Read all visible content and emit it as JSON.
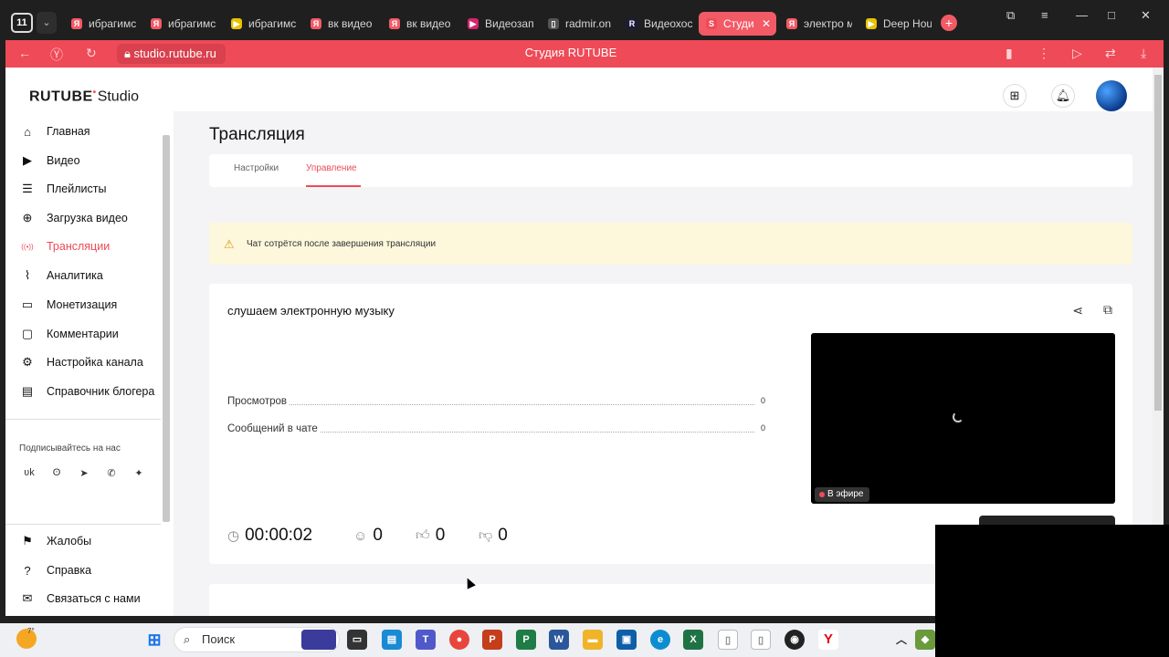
{
  "browser": {
    "tab_count": "11",
    "tabs": [
      {
        "label": "ибрагимс",
        "fav": "Я",
        "color": "#f25a66"
      },
      {
        "label": "ибрагимс",
        "fav": "Я",
        "color": "#f25a66"
      },
      {
        "label": "ибрагимс",
        "fav": "▶",
        "color": "#e8c200"
      },
      {
        "label": "вк видео",
        "fav": "Я",
        "color": "#f25a66"
      },
      {
        "label": "вк видео",
        "fav": "Я",
        "color": "#f25a66"
      },
      {
        "label": "Видеозап",
        "fav": "▶",
        "color": "#d6246e"
      },
      {
        "label": "radmir.on",
        "fav": "▯",
        "color": "#555"
      },
      {
        "label": "Видеохос",
        "fav": "R",
        "color": "#1a1a3a"
      },
      {
        "label": "Студи",
        "fav": "S",
        "color": "#ef4a57",
        "active": true
      },
      {
        "label": "электро м",
        "fav": "Я",
        "color": "#f25a66"
      },
      {
        "label": "Deep Hou",
        "fav": "▶",
        "color": "#e8c200"
      }
    ],
    "url": "studio.rutube.ru",
    "page_title": "Студия RUTUBE"
  },
  "app": {
    "logo_main": "RUTUBE",
    "logo_studio": "Studio",
    "sidebar": [
      {
        "label": "Главная",
        "icon": "home-icon",
        "glyph": "⌂"
      },
      {
        "label": "Видео",
        "icon": "video-icon",
        "glyph": "▶"
      },
      {
        "label": "Плейлисты",
        "icon": "playlist-icon",
        "glyph": "☰"
      },
      {
        "label": "Загрузка видео",
        "icon": "upload-icon",
        "glyph": "⊕"
      },
      {
        "label": "Трансляции",
        "icon": "broadcast-icon",
        "glyph": "((•))",
        "active": true
      },
      {
        "label": "Аналитика",
        "icon": "analytics-icon",
        "glyph": "⌇"
      },
      {
        "label": "Монетизация",
        "icon": "monetization-icon",
        "glyph": "▭"
      },
      {
        "label": "Комментарии",
        "icon": "comments-icon",
        "glyph": "▢"
      },
      {
        "label": "Настройка канала",
        "icon": "settings-icon",
        "glyph": "⚙"
      },
      {
        "label": "Справочник блогера",
        "icon": "handbook-icon",
        "glyph": "▤"
      }
    ],
    "subscribe_heading": "Подписывайтесь на нас",
    "social": [
      "vk",
      "ok",
      "telegram",
      "viber",
      "dzen"
    ],
    "social_glyphs": [
      "ʋk",
      "ʘ",
      "➤",
      "✆",
      "✦"
    ],
    "bottom_nav": [
      {
        "label": "Жалобы",
        "icon": "flag-icon",
        "glyph": "⚑"
      },
      {
        "label": "Справка",
        "icon": "help-icon",
        "glyph": "?"
      },
      {
        "label": "Связаться с нами",
        "icon": "mail-icon",
        "glyph": "✉"
      }
    ],
    "page_title": "Трансляция",
    "tabs": [
      {
        "label": "Настройки"
      },
      {
        "label": "Управление",
        "active": true
      }
    ],
    "warning": "Чат сотрётся после завершения трансляции",
    "stream": {
      "title": "слушаем электронную музыку",
      "stats": [
        {
          "label": "Просмотров",
          "value": "0"
        },
        {
          "label": "Сообщений в чате",
          "value": "0"
        }
      ],
      "live_badge": "В эфире",
      "duration": "00:00:02",
      "viewers": "0",
      "likes": "0",
      "dislikes": "0"
    }
  },
  "taskbar": {
    "weather": "7°",
    "search_placeholder": "Поиск"
  }
}
